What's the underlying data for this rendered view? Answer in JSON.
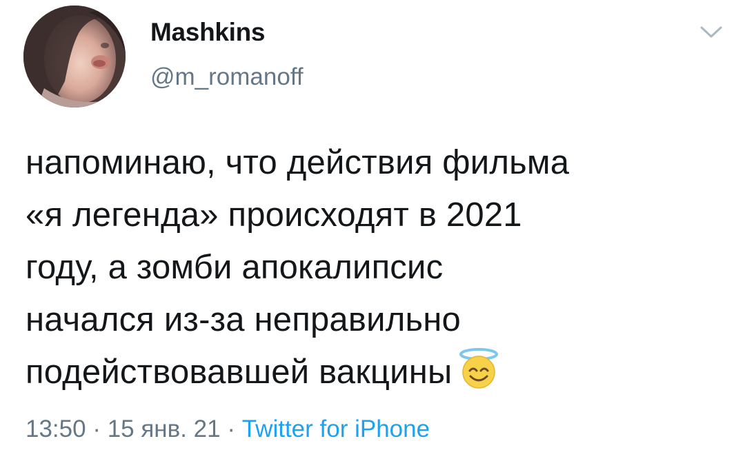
{
  "user": {
    "display_name": "Mashkins",
    "handle": "@m_romanoff"
  },
  "tweet": {
    "lines": [
      "напоминаю, что действия фильма",
      "«я легенда» происходят в 2021",
      "году, а зомби апокалипсис",
      "начался из-за неправильно",
      "подействовавшей вакцины"
    ],
    "emoji": "smiling-face-with-halo"
  },
  "meta": {
    "time": "13:50",
    "separator1": " · ",
    "date": "15 янв. 21",
    "separator2": " · ",
    "source": "Twitter for iPhone"
  },
  "icons": {
    "menu": "chevron-down-icon"
  },
  "colors": {
    "text": "#14171a",
    "secondary": "#657786",
    "link": "#1da1f2"
  }
}
